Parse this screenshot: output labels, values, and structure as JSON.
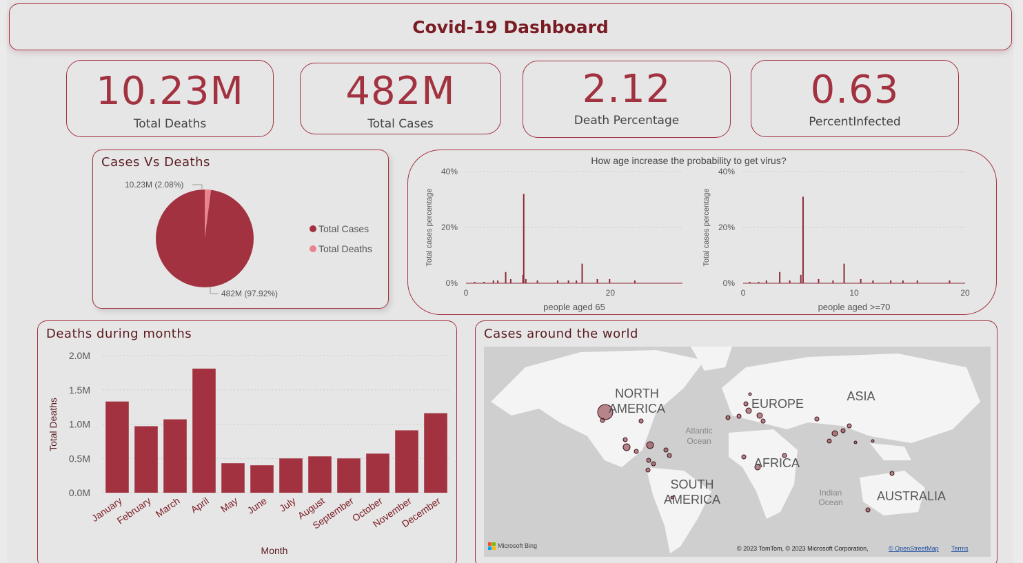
{
  "header": {
    "title": "Covid-19 Dashboard"
  },
  "kpis": [
    {
      "value": "10.23M",
      "label": "Total Deaths"
    },
    {
      "value": "482M",
      "label": "Total Cases"
    },
    {
      "value": "2.12",
      "label": "Death Percentage"
    },
    {
      "value": "0.63",
      "label": "PercentInfected"
    }
  ],
  "pie": {
    "title": "Cases Vs Deaths",
    "slices": [
      {
        "name": "Total Cases",
        "label": "482M (97.92%)",
        "color": "#a23240"
      },
      {
        "name": "Total Deaths",
        "label": "10.23M (2.08%)",
        "color": "#e8848e"
      }
    ]
  },
  "age_panel": {
    "title": "How age increase the probability to get virus?",
    "ylabel": "Total cases percentage"
  },
  "bar_panel": {
    "title": "Deaths during months"
  },
  "map": {
    "title": "Cases around the world",
    "continents": [
      "NORTH AMERICA",
      "EUROPE",
      "ASIA",
      "AFRICA",
      "SOUTH AMERICA",
      "AUSTRALIA"
    ],
    "oceans": [
      "Atlantic Ocean",
      "Indian Ocean"
    ],
    "logo": "Microsoft Bing",
    "attribution": "© 2023 TomTom, © 2023 Microsoft Corporation,",
    "osm_link": "© OpenStreetMap",
    "terms_link": "Terms"
  },
  "chart_data": [
    {
      "type": "pie",
      "title": "Cases Vs Deaths",
      "categories": [
        "Total Cases",
        "Total Deaths"
      ],
      "values": [
        482,
        10.23
      ],
      "labels": [
        "482M (97.92%)",
        "10.23M (2.08%)"
      ],
      "legend": "right"
    },
    {
      "type": "bar",
      "title": "",
      "xlabel": "people aged 65",
      "ylabel": "Total cases percentage",
      "ylim": [
        0,
        40
      ],
      "yticks": [
        "0%",
        "20%",
        "40%"
      ],
      "xticks": [
        "0",
        "20"
      ],
      "x": [
        1.2,
        2.5,
        3.8,
        4.4,
        5.5,
        6.2,
        7.9,
        8.0,
        8.3,
        9.9,
        12.7,
        14.2,
        15.3,
        16.1,
        18.2,
        19.9,
        23.4
      ],
      "values": [
        0.5,
        0.5,
        1,
        1,
        4,
        1.5,
        3,
        32,
        1.5,
        1,
        1,
        1,
        1,
        7,
        1.5,
        1.5,
        1
      ],
      "grid": true
    },
    {
      "type": "bar",
      "title": "",
      "xlabel": "people aged >=70",
      "ylabel": "Total cases percentage",
      "ylim": [
        0,
        40
      ],
      "yticks": [
        "0%",
        "20%",
        "40%"
      ],
      "xticks": [
        "0",
        "10",
        "20"
      ],
      "x": [
        0.6,
        1.4,
        2.1,
        3.3,
        4.2,
        5.2,
        5.4,
        6.8,
        8.1,
        9.1,
        10.6,
        11.7,
        13.3,
        14.4,
        15.7,
        18.6
      ],
      "values": [
        0.5,
        0.5,
        1,
        4,
        1,
        3,
        31,
        1.5,
        1,
        7,
        1.5,
        1,
        1,
        1,
        1,
        1
      ],
      "grid": true
    },
    {
      "type": "bar",
      "title": "Deaths during months",
      "xlabel": "Month",
      "ylabel": "Total Deaths",
      "ylim": [
        0,
        2000000
      ],
      "yticks": [
        "0.0M",
        "0.5M",
        "1.0M",
        "1.5M",
        "2.0M"
      ],
      "categories": [
        "January",
        "February",
        "March",
        "April",
        "May",
        "June",
        "July",
        "August",
        "September",
        "October",
        "November",
        "December"
      ],
      "values": [
        1330000,
        970000,
        1070000,
        1810000,
        430000,
        400000,
        500000,
        530000,
        500000,
        570000,
        910000,
        1160000
      ],
      "grid": true
    }
  ]
}
